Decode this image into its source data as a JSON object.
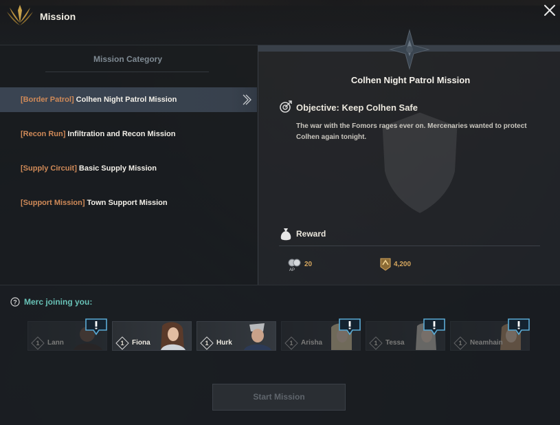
{
  "window": {
    "title": "Mission"
  },
  "category_panel": {
    "title": "Mission Category",
    "missions": [
      {
        "tag": "[Border Patrol]",
        "name": "Colhen Night Patrol Mission",
        "selected": true
      },
      {
        "tag": "[Recon Run]",
        "name": "Infiltration and Recon Mission",
        "selected": false
      },
      {
        "tag": "[Supply Circuit]",
        "name": "Basic Supply Mission",
        "selected": false
      },
      {
        "tag": "[Support Mission]",
        "name": "Town Support Mission",
        "selected": false
      }
    ]
  },
  "detail": {
    "mission_name": "Colhen Night Patrol Mission",
    "objective_title": "Objective: Keep Colhen Safe",
    "objective_desc": "The war with the Fomors rages ever on. Mercenaries wanted to protect Colhen again tonight.",
    "reward_label": "Reward",
    "rewards": [
      {
        "icon": "ap-icon",
        "value": "20"
      },
      {
        "icon": "xp-icon",
        "value": "4,200"
      }
    ]
  },
  "mercs": {
    "title": "Merc joining you:",
    "list": [
      {
        "name": "Lann",
        "level": "1",
        "available": false,
        "alert": true
      },
      {
        "name": "Fiona",
        "level": "1",
        "available": true,
        "alert": false
      },
      {
        "name": "Hurk",
        "level": "1",
        "available": true,
        "alert": false
      },
      {
        "name": "Arisha",
        "level": "1",
        "available": false,
        "alert": true
      },
      {
        "name": "Tessa",
        "level": "1",
        "available": false,
        "alert": true
      },
      {
        "name": "Neamhain",
        "level": "1",
        "available": false,
        "alert": true
      }
    ]
  },
  "start_button": {
    "label": "Start Mission",
    "enabled": false
  },
  "colors": {
    "accent_tag": "#d08a58",
    "merc_title": "#68c1b6",
    "reward_value": "#d6a75e",
    "alert_border": "#5aaad4"
  }
}
